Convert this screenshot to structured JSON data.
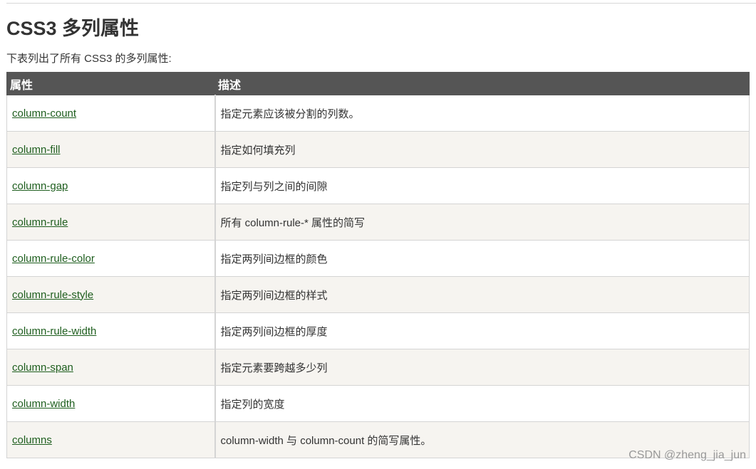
{
  "page": {
    "heading": "CSS3 多列属性",
    "intro": "下表列出了所有 CSS3 的多列属性:"
  },
  "table": {
    "headers": [
      "属性",
      "描述"
    ],
    "rows": [
      {
        "property": "column-count",
        "description": "指定元素应该被分割的列数。"
      },
      {
        "property": "column-fill",
        "description": "指定如何填充列"
      },
      {
        "property": "column-gap",
        "description": "指定列与列之间的间隙"
      },
      {
        "property": "column-rule",
        "description": "所有 column-rule-* 属性的简写"
      },
      {
        "property": "column-rule-color",
        "description": "指定两列间边框的颜色"
      },
      {
        "property": "column-rule-style",
        "description": "指定两列间边框的样式"
      },
      {
        "property": "column-rule-width",
        "description": "指定两列间边框的厚度"
      },
      {
        "property": "column-span",
        "description": "指定元素要跨越多少列"
      },
      {
        "property": "column-width",
        "description": "指定列的宽度"
      },
      {
        "property": "columns",
        "description": "column-width 与 column-count 的简写属性。"
      }
    ]
  },
  "watermark": "CSDN @zheng_jia_jun",
  "colors": {
    "header_bg": "#555555",
    "link": "#1e5e1e",
    "even_row_bg": "#f6f4f0"
  }
}
